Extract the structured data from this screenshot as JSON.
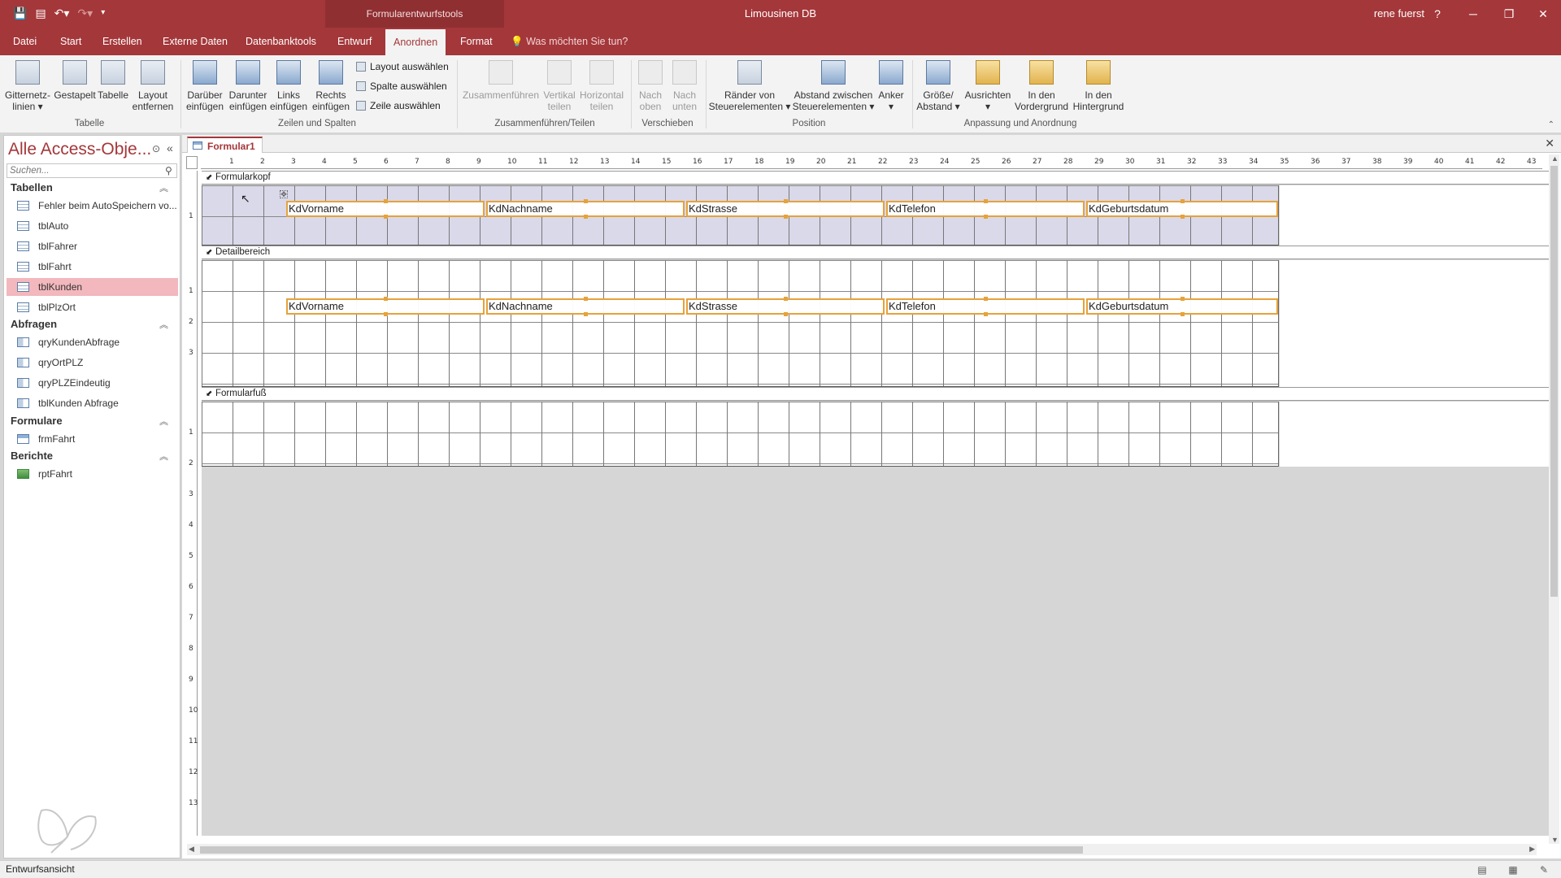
{
  "titlebar": {
    "context_tools": "Formularentwurfstools",
    "app_title": "Limousinen DB",
    "user": "rene fuerst",
    "help": "?",
    "minimize": "─",
    "restore": "❐",
    "close": "✕"
  },
  "ribbon_tabs": [
    {
      "label": "Datei"
    },
    {
      "label": "Start"
    },
    {
      "label": "Erstellen"
    },
    {
      "label": "Externe Daten"
    },
    {
      "label": "Datenbanktools"
    },
    {
      "label": "Entwurf"
    },
    {
      "label": "Anordnen",
      "active": true
    },
    {
      "label": "Format"
    }
  ],
  "tellme": "Was möchten Sie tun?",
  "ribbon": {
    "gitternetz": "Gitternetz-\nlinien ▾",
    "gestapelt": "Gestapelt",
    "tabelle": "Tabelle",
    "layout_entfernen": "Layout\nentfernen",
    "darueber": "Darüber\neinfügen",
    "darunter": "Darunter\neinfügen",
    "links": "Links\neinfügen",
    "rechts": "Rechts\neinfügen",
    "layout_auswaehlen": "Layout auswählen",
    "spalte_auswaehlen": "Spalte auswählen",
    "zeile_auswaehlen": "Zeile auswählen",
    "zusammenfuehren": "Zusammenführen",
    "vertikal_teilen": "Vertikal\nteilen",
    "horizontal_teilen": "Horizontal\nteilen",
    "nach_oben": "Nach\noben",
    "nach_unten": "Nach\nunten",
    "raender": "Ränder von\nSteuerelementen ▾",
    "abstand": "Abstand zwischen\nSteuerelementen ▾",
    "anker": "Anker\n▾",
    "groesse": "Größe/\nAbstand ▾",
    "ausrichten": "Ausrichten\n▾",
    "vordergrund": "In den\nVordergrund",
    "hintergrund": "In den\nHintergrund",
    "groups": {
      "tabelle": "Tabelle",
      "zeilen_spalten": "Zeilen und Spalten",
      "zusammenfuehren_teilen": "Zusammenführen/Teilen",
      "verschieben": "Verschieben",
      "position": "Position",
      "anpassung": "Anpassung und Anordnung"
    }
  },
  "nav": {
    "title": "Alle Access-Obje...",
    "search_placeholder": "Suchen...",
    "groups": {
      "tabellen": "Tabellen",
      "abfragen": "Abfragen",
      "formulare": "Formulare",
      "berichte": "Berichte"
    },
    "tabellen": [
      "Fehler beim AutoSpeichern vo...",
      "tblAuto",
      "tblFahrer",
      "tblFahrt",
      "tblKunden",
      "tblPlzOrt"
    ],
    "selected_table": "tblKunden",
    "abfragen": [
      "qryKundenAbfrage",
      "qryOrtPLZ",
      "qryPLZEindeutig",
      "tblKunden Abfrage"
    ],
    "formulare": [
      "frmFahrt"
    ],
    "berichte": [
      "rptFahrt"
    ]
  },
  "document": {
    "tab_label": "Formular1",
    "sections": {
      "header": "Formularkopf",
      "detail": "Detailbereich",
      "footer": "Formularfuß"
    },
    "header_labels": [
      "KdVorname",
      "KdNachname",
      "KdStrasse",
      "KdTelefon",
      "KdGeburtsdatum"
    ],
    "detail_fields": [
      "KdVorname",
      "KdNachname",
      "KdStrasse",
      "KdTelefon",
      "KdGeburtsdatum"
    ],
    "ruler_ticks": [
      "1",
      "2",
      "3",
      "4",
      "5",
      "6",
      "7",
      "8",
      "9",
      "10",
      "11",
      "12",
      "13",
      "14",
      "15",
      "16",
      "17",
      "18",
      "19",
      "20",
      "21",
      "22",
      "23",
      "24",
      "25",
      "26",
      "27",
      "28",
      "29",
      "30",
      "31",
      "32",
      "33",
      "34",
      "35",
      "36",
      "37",
      "38",
      "39",
      "40",
      "41",
      "42",
      "43"
    ],
    "ruler_v_header": [
      "1"
    ],
    "ruler_v_detail": [
      "1",
      "2",
      "3"
    ],
    "ruler_v_footer": [
      "1",
      "2",
      "3",
      "4",
      "5",
      "6",
      "7",
      "8",
      "9",
      "10",
      "11",
      "12",
      "13"
    ]
  },
  "statusbar": {
    "mode": "Entwurfsansicht"
  },
  "colors": {
    "accent": "#a4373a",
    "selection": "#e6a23c",
    "header_section": "#dad9ea"
  }
}
